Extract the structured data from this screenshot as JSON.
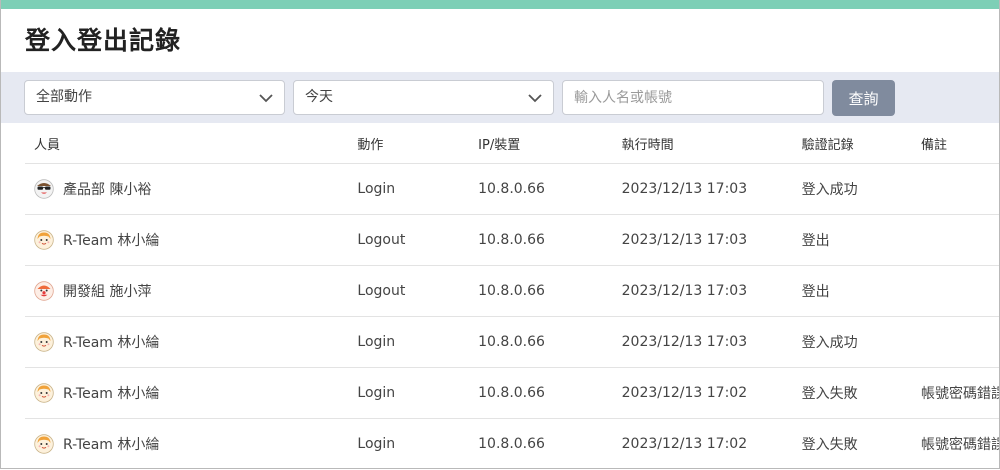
{
  "page": {
    "title": "登入登出記錄"
  },
  "filters": {
    "action_select": {
      "value": "全部動作"
    },
    "date_select": {
      "value": "今天"
    },
    "search": {
      "placeholder": "輸入人名或帳號",
      "value": ""
    },
    "query_label": "查詢"
  },
  "table": {
    "headers": {
      "user": "人員",
      "action": "動作",
      "ip": "IP/裝置",
      "time": "執行時間",
      "verify": "驗證記錄",
      "note": "備註"
    },
    "rows": [
      {
        "avatar": "sunglasses-avatar-icon",
        "user": "產品部 陳小裕",
        "action": "Login",
        "ip": "10.8.0.66",
        "time": "2023/12/13 17:03",
        "verify": "登入成功",
        "note": ""
      },
      {
        "avatar": "girl-avatar-icon",
        "user": "R-Team 林小綸",
        "action": "Logout",
        "ip": "10.8.0.66",
        "time": "2023/12/13 17:03",
        "verify": "登出",
        "note": ""
      },
      {
        "avatar": "clown-avatar-icon",
        "user": "開發組 施小萍",
        "action": "Logout",
        "ip": "10.8.0.66",
        "time": "2023/12/13 17:03",
        "verify": "登出",
        "note": ""
      },
      {
        "avatar": "girl-avatar-icon",
        "user": "R-Team 林小綸",
        "action": "Login",
        "ip": "10.8.0.66",
        "time": "2023/12/13 17:03",
        "verify": "登入成功",
        "note": ""
      },
      {
        "avatar": "girl-avatar-icon",
        "user": "R-Team 林小綸",
        "action": "Login",
        "ip": "10.8.0.66",
        "time": "2023/12/13 17:02",
        "verify": "登入失敗",
        "note": "帳號密碼錯誤"
      },
      {
        "avatar": "girl-avatar-icon",
        "user": "R-Team 林小綸",
        "action": "Login",
        "ip": "10.8.0.66",
        "time": "2023/12/13 17:02",
        "verify": "登入失敗",
        "note": "帳號密碼錯誤"
      }
    ]
  },
  "colors": {
    "accent_bar": "#7dcfb6",
    "filter_bg": "#e6e9f2",
    "button_bg": "#808b9e"
  }
}
